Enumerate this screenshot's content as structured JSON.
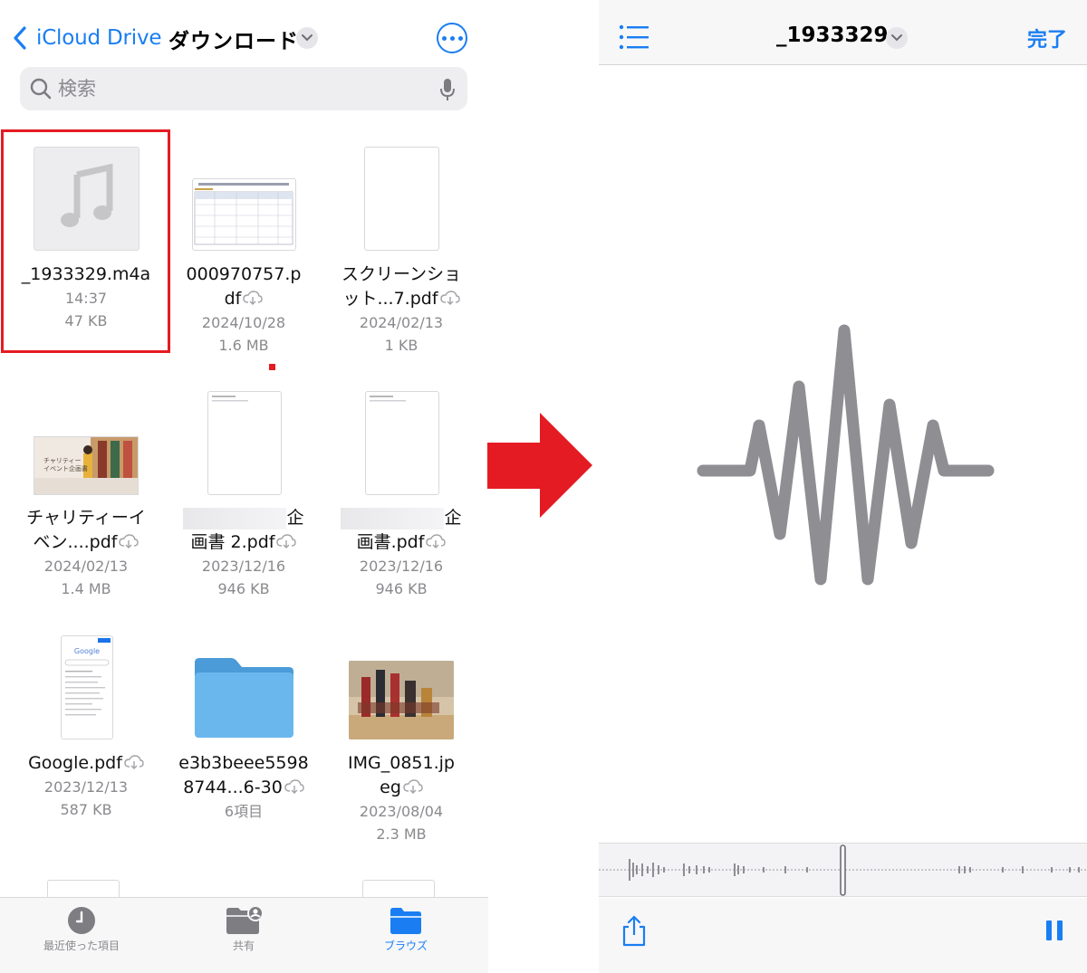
{
  "left": {
    "nav": {
      "back_label": "iCloud Drive",
      "folder_title": "ダウンロード"
    },
    "search": {
      "placeholder": "検索"
    },
    "files": [
      {
        "name": "_1933329.m4a",
        "line2": "",
        "date": "14:37",
        "size": "47 KB",
        "thumb": "music-icon"
      },
      {
        "name": "000970757.p",
        "line2": "df",
        "date": "2024/10/28",
        "size": "1.6 MB",
        "thumb": "pdf-table"
      },
      {
        "name": "スクリーンショ",
        "line2": "ット...7.pdf",
        "date": "2024/02/13",
        "size": "1 KB",
        "thumb": "blank-page"
      },
      {
        "name": "チャリティーイ",
        "line2": "ベン....pdf",
        "date": "2024/02/13",
        "size": "1.4 MB",
        "thumb": "slide-photo"
      },
      {
        "name": "企",
        "line2": "画書 2.pdf",
        "date": "2023/12/16",
        "size": "946 KB",
        "thumb": "doc-page"
      },
      {
        "name": "企",
        "line2": "画書.pdf",
        "date": "2023/12/16",
        "size": "946 KB",
        "thumb": "doc-page"
      },
      {
        "name": "Google.pdf",
        "line2": "",
        "date": "2023/12/13",
        "size": "587 KB",
        "thumb": "google-page",
        "thumb_text": "Google"
      },
      {
        "name": "e3b3beee5598",
        "line2": "8744...6-30",
        "date": "6項目",
        "size": "",
        "thumb": "folder"
      },
      {
        "name": "IMG_0851.jp",
        "line2": "eg",
        "date": "2023/08/04",
        "size": "2.3 MB",
        "thumb": "photo"
      }
    ],
    "slide_caption": "チャリティー\nイベント企画書",
    "tabs": [
      {
        "label": "最近使った項目",
        "icon": "clock-icon",
        "active": false
      },
      {
        "label": "共有",
        "icon": "shared-folder-icon",
        "active": false
      },
      {
        "label": "ブラウズ",
        "icon": "folder-icon",
        "active": true
      }
    ]
  },
  "right": {
    "title": "_1933329",
    "done_label": "完了"
  },
  "colors": {
    "accent": "#1a7ef2",
    "highlight": "#e41b23",
    "waveform": "#8e8e93"
  }
}
